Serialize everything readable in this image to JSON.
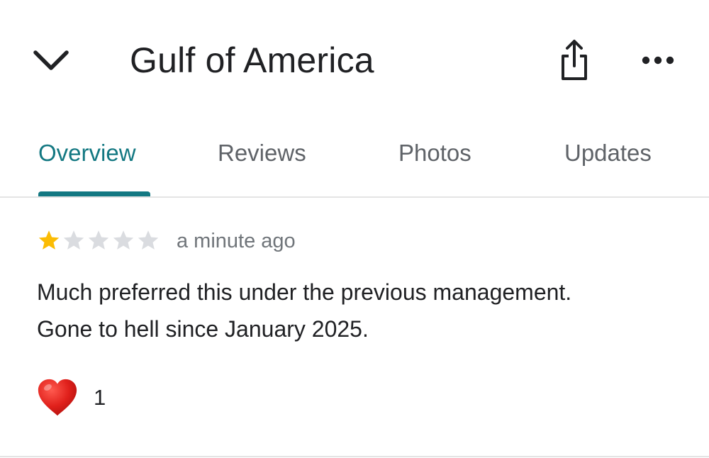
{
  "header": {
    "title": "Gulf of America",
    "collapse_icon": "chevron-down-icon",
    "share_icon": "share-icon",
    "more_icon": "more-horizontal-icon"
  },
  "tabs": [
    {
      "label": "Overview",
      "active": true
    },
    {
      "label": "Reviews",
      "active": false
    },
    {
      "label": "Photos",
      "active": false
    },
    {
      "label": "Updates",
      "active": false
    }
  ],
  "review": {
    "rating": 1,
    "max_rating": 5,
    "time": "a minute ago",
    "text_line1": "Much preferred this under the previous management.",
    "text_line2": "Gone to hell since January 2025.",
    "reaction_icon": "heart-icon",
    "reaction_count": "1"
  },
  "colors": {
    "accent": "#137882",
    "star_filled": "#fbbc04",
    "star_empty": "#dadce0",
    "heart": "#e0201b"
  }
}
